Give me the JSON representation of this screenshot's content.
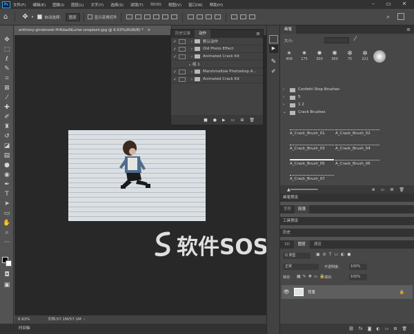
{
  "app": {
    "logo": "Ps"
  },
  "menubar": {
    "items": [
      "文件(F)",
      "编辑(E)",
      "图像(I)",
      "图层(L)",
      "文字(Y)",
      "选择(S)",
      "滤镜(T)",
      "3D(D)",
      "视图(V)",
      "窗口(W)",
      "帮助(H)"
    ]
  },
  "optionsbar": {
    "auto_select_label": "自动选择：",
    "auto_select_value": "图层",
    "show_transform_label": "显示变换控件"
  },
  "document": {
    "tab_title": "anthony-ginsbrook-Hr6dazNLxhw-unsplash.jpg @ 6.63%(RGB/8) *",
    "zoom": "6.63%",
    "doc_info": "文档:57.1M/57.1M"
  },
  "bottombar": {
    "label": "时间轴"
  },
  "actions_panel": {
    "tabs": [
      "历史记录",
      "动作"
    ],
    "rows": [
      {
        "check": "✓",
        "arrow": "›",
        "label": "默认动作",
        "level": 0
      },
      {
        "check": "✓",
        "arrow": "›",
        "label": "Old Photo Effect",
        "level": 0
      },
      {
        "check": "✓",
        "arrow": "›",
        "label": "Animated Crack Kit",
        "level": 0
      },
      {
        "check": "",
        "arrow": "⌄",
        "label": "组 1",
        "level": 1
      },
      {
        "check": "✓",
        "arrow": "›",
        "label": "Marshmallow Photoshop A...",
        "level": 0
      },
      {
        "check": "✓",
        "arrow": "›",
        "label": "Animated Crack Kit",
        "level": 0
      }
    ]
  },
  "brushes_panel": {
    "title": "画笔",
    "size_label": "大小:",
    "sizes": [
      "408",
      "175",
      "300",
      "300",
      "75",
      "221"
    ],
    "groups": [
      {
        "arrow": "›",
        "label": "Confetti Stop Brushes"
      },
      {
        "arrow": "›",
        "label": "5"
      },
      {
        "arrow": "›",
        "label": "1 2"
      },
      {
        "arrow": "⌄",
        "label": "Crack Brushes"
      }
    ],
    "brushes": [
      "A_Crack_Brush_01",
      "A_Crack_Brush_02",
      "A_Crack_Brush_03",
      "A_Crack_Brush_04",
      "A_Crack_Brush_05",
      "A_Crack_Brush_06",
      "A_Crack_Brush_07"
    ]
  },
  "brush_presets_label": "画笔预设",
  "mid_tabs": [
    "字符",
    "段落"
  ],
  "tool_presets_label": "工具预设",
  "history_label": "历史",
  "layers_panel": {
    "tabs": [
      "3D",
      "图层",
      "通道"
    ],
    "kind_label": "Q 类型",
    "blend_mode": "正常",
    "opacity_label": "不透明度:",
    "opacity_value": "100%",
    "lock_label": "锁定:",
    "fill_label": "填充:",
    "fill_value": "100%",
    "layer_name": "背景"
  },
  "watermark": {
    "text": "软件SOS"
  }
}
